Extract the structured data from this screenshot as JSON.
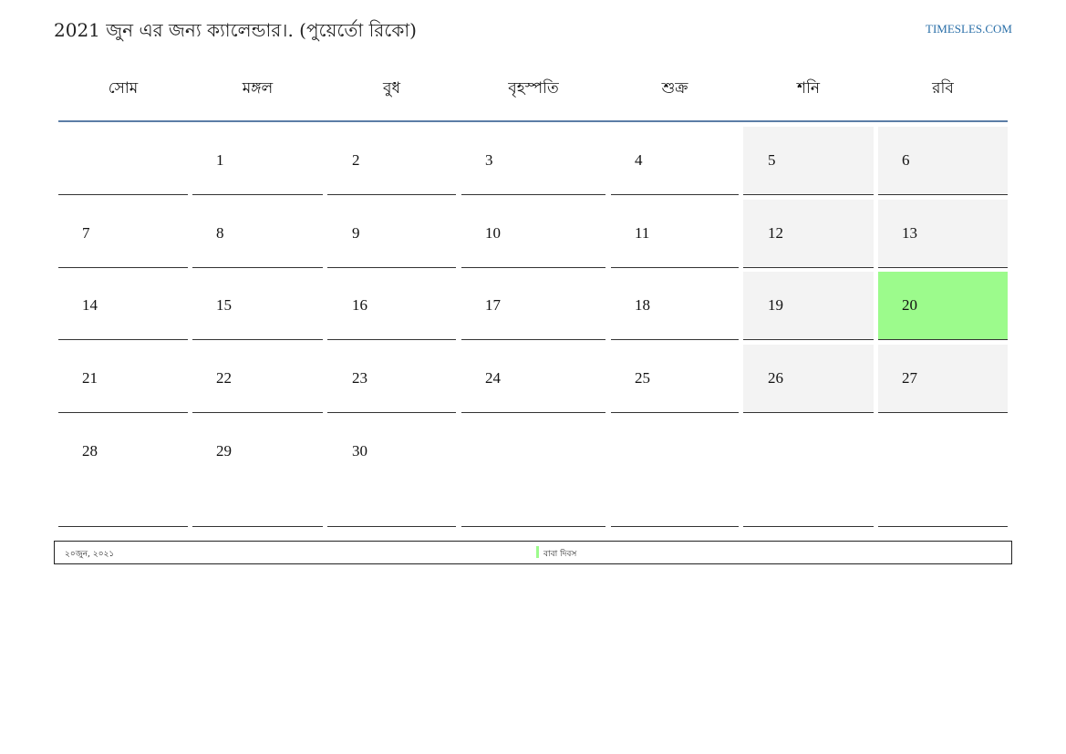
{
  "header": {
    "title": "2021 জুন এর জন্য ক্যালেন্ডার।. (পুয়ের্তো রিকো)",
    "site": "TIMESLES.COM"
  },
  "weekdays": [
    "সোম",
    "মঙ্গল",
    "বুধ",
    "বৃহস্পতি",
    "শুক্র",
    "শনি",
    "রবি"
  ],
  "weeks": [
    [
      "",
      "1",
      "2",
      "3",
      "4",
      "5",
      "6"
    ],
    [
      "7",
      "8",
      "9",
      "10",
      "11",
      "12",
      "13"
    ],
    [
      "14",
      "15",
      "16",
      "17",
      "18",
      "19",
      "20"
    ],
    [
      "21",
      "22",
      "23",
      "24",
      "25",
      "26",
      "27"
    ],
    [
      "28",
      "29",
      "30",
      "",
      "",
      "",
      ""
    ]
  ],
  "highlighted_day": "20",
  "colors": {
    "weekend_bg": "#f3f3f3",
    "holiday_bg": "#9cfb8c",
    "header_rule": "#5b7da6",
    "link": "#2a6fa8"
  },
  "holidays": [
    {
      "date": "২০জুন, ২০২১",
      "name": "বাবা দিবস"
    }
  ]
}
